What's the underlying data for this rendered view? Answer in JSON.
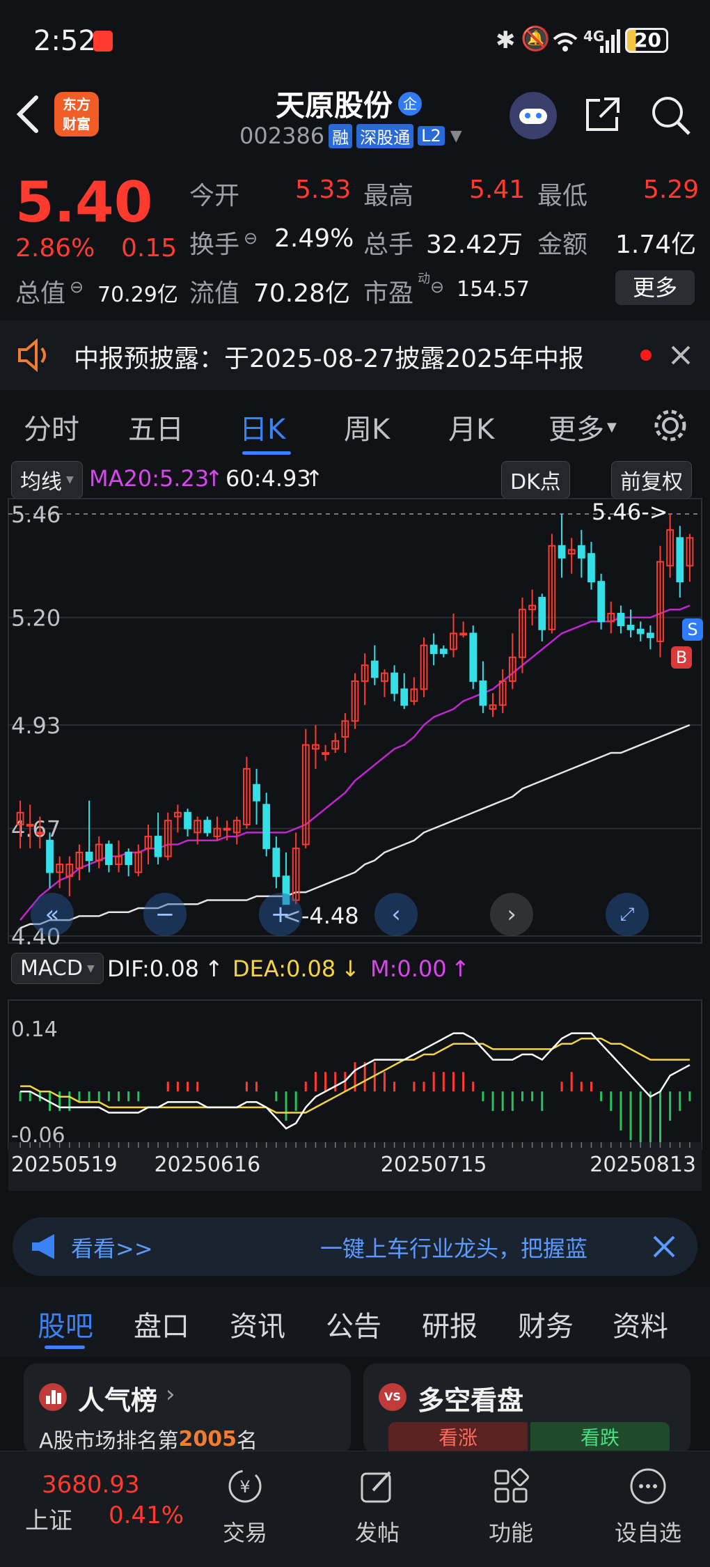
{
  "status_bar": {
    "time": "2:52",
    "battery": "20",
    "network": "4G"
  },
  "header": {
    "name": "天原股份",
    "badge": "企",
    "code": "002386",
    "tags": [
      "融",
      "深股通",
      "L2"
    ],
    "brand": "东方财富",
    "brand_line1": "东方",
    "brand_line2": "财富"
  },
  "quote": {
    "price": "5.40",
    "change_pct": "2.86%",
    "change": "0.15",
    "open_label": "今开",
    "open": "5.33",
    "high_label": "最高",
    "high": "5.41",
    "low_label": "最低",
    "low": "5.29",
    "turnover_label": "换手",
    "turnover": "2.49%",
    "volume_label": "总手",
    "volume": "32.42万",
    "amount_label": "金额",
    "amount": "1.74亿",
    "mktcap_label": "总值",
    "mktcap": "70.29亿",
    "float_label": "流值",
    "float": "70.28亿",
    "pe_label": "市盈",
    "pe_sup": "动",
    "pe": "154.57",
    "more_label": "更多"
  },
  "notice": {
    "text": "中报预披露：于2025-08-27披露2025年中报"
  },
  "chart_tabs": [
    "分时",
    "五日",
    "日K",
    "周K",
    "月K",
    "更多"
  ],
  "chart_tab_active": 2,
  "kline": {
    "ma_label": "均线",
    "ma20": "MA20:5.23",
    "ma60": "60:4.93",
    "dk_label": "DK点",
    "adjust_label": "前复权",
    "max_marker": "5.46->",
    "min_marker": "<-4.48",
    "s_badge": "S",
    "b_badge": "B"
  },
  "macd": {
    "label": "MACD",
    "dif": "DIF:0.08",
    "dea": "DEA:0.08",
    "m": "M:0.00"
  },
  "chart_data": {
    "type": "candlestick",
    "price_axis_ticks": [
      "5.46",
      "5.20",
      "4.93",
      "4.67",
      "4.40"
    ],
    "ylim": [
      4.4,
      5.46
    ],
    "macd_axis_ticks": [
      "0.14",
      "-0.06"
    ],
    "macd_ylim": [
      -0.06,
      0.14
    ],
    "x_tick_labels": [
      "20250519",
      "20250616",
      "20250715",
      "20250813"
    ],
    "candles": [
      [
        4.68,
        4.71,
        4.62,
        4.74
      ],
      [
        4.68,
        4.68,
        4.62,
        4.73
      ],
      [
        4.66,
        4.66,
        4.62,
        4.7
      ],
      [
        4.64,
        4.56,
        4.52,
        4.66
      ],
      [
        4.56,
        4.58,
        4.52,
        4.6
      ],
      [
        4.55,
        4.58,
        4.5,
        4.6
      ],
      [
        4.57,
        4.61,
        4.54,
        4.63
      ],
      [
        4.61,
        4.59,
        4.56,
        4.74
      ],
      [
        4.59,
        4.63,
        4.57,
        4.65
      ],
      [
        4.63,
        4.58,
        4.56,
        4.64
      ],
      [
        4.58,
        4.6,
        4.56,
        4.64
      ],
      [
        4.61,
        4.58,
        4.55,
        4.62
      ],
      [
        4.56,
        4.61,
        4.55,
        4.63
      ],
      [
        4.62,
        4.65,
        4.58,
        4.68
      ],
      [
        4.65,
        4.6,
        4.58,
        4.71
      ],
      [
        4.6,
        4.69,
        4.59,
        4.71
      ],
      [
        4.7,
        4.71,
        4.66,
        4.73
      ],
      [
        4.71,
        4.67,
        4.65,
        4.72
      ],
      [
        4.66,
        4.69,
        4.63,
        4.7
      ],
      [
        4.69,
        4.66,
        4.65,
        4.7
      ],
      [
        4.65,
        4.67,
        4.64,
        4.7
      ],
      [
        4.67,
        4.67,
        4.64,
        4.69
      ],
      [
        4.66,
        4.69,
        4.63,
        4.7
      ],
      [
        4.68,
        4.82,
        4.67,
        4.85
      ],
      [
        4.78,
        4.74,
        4.68,
        4.82
      ],
      [
        4.73,
        4.62,
        4.6,
        4.76
      ],
      [
        4.62,
        4.55,
        4.52,
        4.65
      ],
      [
        4.55,
        4.48,
        4.48,
        4.61
      ],
      [
        4.49,
        4.62,
        4.48,
        4.66
      ],
      [
        4.63,
        4.88,
        4.62,
        4.92
      ],
      [
        4.87,
        4.88,
        4.82,
        4.93
      ],
      [
        4.86,
        4.86,
        4.84,
        4.88
      ],
      [
        4.87,
        4.89,
        4.86,
        4.91
      ],
      [
        4.9,
        4.94,
        4.86,
        4.96
      ],
      [
        4.94,
        5.04,
        4.92,
        5.06
      ],
      [
        5.04,
        5.08,
        4.98,
        5.11
      ],
      [
        5.09,
        5.05,
        5.03,
        5.13
      ],
      [
        5.04,
        5.06,
        5.0,
        5.07
      ],
      [
        5.06,
        5.01,
        4.99,
        5.08
      ],
      [
        5.02,
        4.98,
        4.97,
        5.06
      ],
      [
        4.99,
        5.02,
        4.98,
        5.05
      ],
      [
        5.02,
        5.13,
        5.0,
        5.15
      ],
      [
        5.13,
        5.11,
        5.08,
        5.16
      ],
      [
        5.12,
        5.11,
        5.1,
        5.13
      ],
      [
        5.12,
        5.16,
        5.1,
        5.21
      ],
      [
        5.16,
        5.16,
        5.15,
        5.19
      ],
      [
        5.16,
        5.04,
        5.02,
        5.18
      ],
      [
        5.04,
        4.98,
        4.96,
        5.09
      ],
      [
        4.97,
        4.98,
        4.95,
        5.01
      ],
      [
        4.98,
        5.04,
        4.96,
        5.07
      ],
      [
        5.04,
        5.1,
        5.02,
        5.16
      ],
      [
        5.1,
        5.22,
        5.06,
        5.25
      ],
      [
        5.22,
        5.23,
        5.18,
        5.27
      ],
      [
        5.25,
        5.17,
        5.14,
        5.26
      ],
      [
        5.17,
        5.38,
        5.16,
        5.41
      ],
      [
        5.38,
        5.35,
        5.3,
        5.46
      ],
      [
        5.36,
        5.37,
        5.31,
        5.4
      ],
      [
        5.38,
        5.35,
        5.3,
        5.42
      ],
      [
        5.36,
        5.29,
        5.27,
        5.39
      ],
      [
        5.29,
        5.19,
        5.17,
        5.31
      ],
      [
        5.19,
        5.21,
        5.16,
        5.24
      ],
      [
        5.21,
        5.18,
        5.16,
        5.23
      ],
      [
        5.18,
        5.17,
        5.15,
        5.22
      ],
      [
        5.17,
        5.16,
        5.14,
        5.19
      ],
      [
        5.16,
        5.15,
        5.12,
        5.18
      ],
      [
        5.14,
        5.34,
        5.1,
        5.38
      ],
      [
        5.33,
        5.42,
        5.3,
        5.46
      ],
      [
        5.4,
        5.29,
        5.25,
        5.43
      ],
      [
        5.33,
        5.4,
        5.29,
        5.41
      ]
    ],
    "ma20": [
      4.44,
      4.47,
      4.5,
      4.52,
      4.54,
      4.55,
      4.57,
      4.58,
      4.59,
      4.6,
      4.6,
      4.61,
      4.61,
      4.62,
      4.62,
      4.63,
      4.63,
      4.64,
      4.64,
      4.64,
      4.64,
      4.65,
      4.65,
      4.66,
      4.66,
      4.66,
      4.66,
      4.66,
      4.67,
      4.68,
      4.7,
      4.72,
      4.74,
      4.76,
      4.79,
      4.81,
      4.83,
      4.85,
      4.87,
      4.88,
      4.9,
      4.93,
      4.95,
      4.96,
      4.97,
      4.99,
      5.0,
      5.01,
      5.02,
      5.04,
      5.06,
      5.08,
      5.1,
      5.12,
      5.14,
      5.16,
      5.17,
      5.18,
      5.19,
      5.19,
      5.19,
      5.2,
      5.2,
      5.2,
      5.2,
      5.21,
      5.22,
      5.22,
      5.23
    ],
    "ma60": [
      4.42,
      4.43,
      4.43,
      4.44,
      4.44,
      4.44,
      4.45,
      4.45,
      4.45,
      4.46,
      4.46,
      4.46,
      4.47,
      4.47,
      4.47,
      4.48,
      4.48,
      4.48,
      4.48,
      4.49,
      4.49,
      4.49,
      4.49,
      4.49,
      4.5,
      4.5,
      4.5,
      4.5,
      4.51,
      4.51,
      4.52,
      4.53,
      4.54,
      4.55,
      4.56,
      4.58,
      4.59,
      4.61,
      4.62,
      4.63,
      4.64,
      4.66,
      4.67,
      4.68,
      4.69,
      4.7,
      4.71,
      4.72,
      4.73,
      4.74,
      4.75,
      4.77,
      4.78,
      4.79,
      4.8,
      4.81,
      4.82,
      4.83,
      4.84,
      4.85,
      4.86,
      4.86,
      4.87,
      4.88,
      4.89,
      4.9,
      4.91,
      4.92,
      4.93
    ],
    "dif": [
      0.02,
      0.02,
      0.01,
      0.0,
      -0.01,
      -0.01,
      -0.01,
      -0.01,
      -0.01,
      -0.02,
      -0.02,
      -0.02,
      -0.02,
      -0.01,
      -0.01,
      0.0,
      0.0,
      0.0,
      0.0,
      -0.01,
      -0.01,
      -0.01,
      -0.01,
      0.0,
      0.0,
      -0.01,
      -0.03,
      -0.05,
      -0.04,
      -0.01,
      0.01,
      0.02,
      0.03,
      0.04,
      0.06,
      0.07,
      0.08,
      0.08,
      0.08,
      0.08,
      0.09,
      0.1,
      0.11,
      0.12,
      0.13,
      0.13,
      0.12,
      0.1,
      0.08,
      0.08,
      0.08,
      0.09,
      0.09,
      0.08,
      0.1,
      0.12,
      0.13,
      0.13,
      0.13,
      0.11,
      0.09,
      0.07,
      0.05,
      0.03,
      0.01,
      0.02,
      0.05,
      0.06,
      0.07
    ],
    "dea": [
      0.03,
      0.03,
      0.02,
      0.02,
      0.01,
      0.01,
      0.0,
      0.0,
      0.0,
      -0.01,
      -0.01,
      -0.01,
      -0.01,
      -0.01,
      -0.01,
      -0.01,
      -0.01,
      -0.01,
      -0.01,
      -0.01,
      -0.01,
      -0.01,
      -0.01,
      -0.01,
      -0.01,
      -0.01,
      -0.02,
      -0.02,
      -0.02,
      -0.02,
      -0.01,
      0.0,
      0.01,
      0.02,
      0.03,
      0.04,
      0.05,
      0.06,
      0.07,
      0.08,
      0.08,
      0.09,
      0.09,
      0.1,
      0.11,
      0.11,
      0.11,
      0.11,
      0.1,
      0.1,
      0.1,
      0.1,
      0.1,
      0.1,
      0.1,
      0.11,
      0.11,
      0.12,
      0.12,
      0.12,
      0.11,
      0.11,
      0.1,
      0.09,
      0.08,
      0.08,
      0.08,
      0.08,
      0.08
    ]
  },
  "ad_banner": {
    "left": "看看>>",
    "right": "一键上车行业龙头，把握蓝"
  },
  "sub_tabs": [
    "股吧",
    "盘口",
    "资讯",
    "公告",
    "研报",
    "财务",
    "资料"
  ],
  "sub_tab_active": 0,
  "cards": {
    "popularity_title": "人气榜",
    "popularity_prefix": "A股市场排名第",
    "popularity_rank": "2005",
    "popularity_suffix": "名",
    "vs_title": "多空看盘",
    "vs_badge": "VS",
    "bull_label": "看涨",
    "bear_label": "看跌"
  },
  "bottom_nav": {
    "index_value": "3680.93",
    "index_name": "上证",
    "index_change": "0.41%",
    "items": [
      "交易",
      "发帖",
      "功能",
      "设自选"
    ]
  },
  "colors": {
    "up": "#ff3b30",
    "down": "#34e0e6",
    "ma20": "#c026d3",
    "ma60": "#e5e5e5",
    "dea": "#f5d442",
    "accent": "#3b82f6"
  }
}
